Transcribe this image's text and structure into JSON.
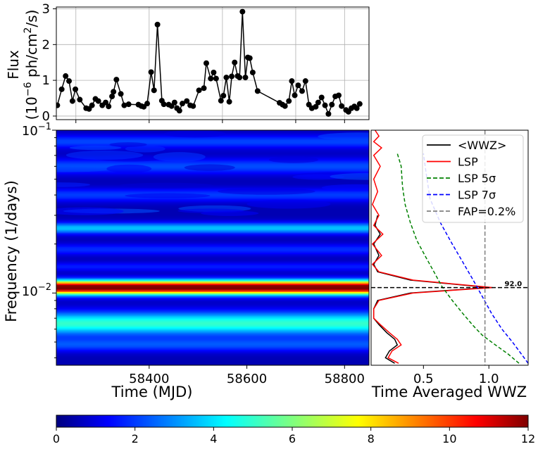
{
  "chart_data": [
    {
      "type": "line",
      "ylabel_line1": "Flux",
      "ylabel_line2_pre": "(10",
      "ylabel_line2_sup1": "−6",
      "ylabel_line2_mid": " ph/cm",
      "ylabel_line2_sup2": "2",
      "ylabel_line2_post": "/s)",
      "xlim": [
        58210,
        58850
      ],
      "ylim": [
        -0.1,
        3.05
      ],
      "yticks": [
        "0",
        "1",
        "2",
        "3"
      ],
      "xtick_values": [
        58250,
        58400,
        58550,
        58700,
        58800
      ],
      "grid": true,
      "line_color": "#000000",
      "series": [
        {
          "x": [
            58212,
            58221,
            58229,
            58236,
            58243,
            58249,
            58258,
            58271,
            58277,
            58283,
            58290,
            58296,
            58304,
            58311,
            58317,
            58324,
            58327,
            58333,
            58342,
            58349,
            58358,
            58378,
            58384,
            58389,
            58396,
            58404,
            58410,
            58417,
            58426,
            58430,
            58440,
            58446,
            58452,
            58457,
            58462,
            58468,
            58477,
            58484,
            58490,
            58502,
            58512,
            58517,
            58526,
            58532,
            58537,
            58547,
            58552,
            58558,
            58564,
            58569,
            58575,
            58581,
            58585,
            58591,
            58597,
            58602,
            58606,
            58612,
            58622,
            58667,
            58673,
            58678,
            58686,
            58692,
            58698,
            58705,
            58713,
            58720,
            58727,
            58733,
            58741,
            58746,
            58753,
            58760,
            58767,
            58774,
            58781,
            58788,
            58794,
            58803,
            58808,
            58814,
            58820,
            58825,
            58831
          ],
          "y": [
            0.3,
            0.75,
            1.12,
            0.98,
            0.42,
            0.75,
            0.46,
            0.22,
            0.2,
            0.3,
            0.48,
            0.42,
            0.3,
            0.38,
            0.27,
            0.55,
            0.68,
            1.02,
            0.62,
            0.3,
            0.33,
            0.32,
            0.28,
            0.26,
            0.35,
            1.23,
            0.72,
            2.56,
            0.43,
            0.33,
            0.32,
            0.28,
            0.38,
            0.22,
            0.15,
            0.35,
            0.42,
            0.3,
            0.28,
            0.72,
            0.78,
            1.48,
            1.05,
            1.22,
            1.05,
            0.43,
            0.57,
            1.08,
            0.4,
            1.11,
            1.5,
            1.12,
            1.08,
            2.92,
            1.08,
            1.64,
            1.62,
            1.22,
            0.7,
            0.37,
            0.32,
            0.28,
            0.42,
            0.98,
            0.58,
            0.86,
            0.7,
            0.98,
            0.32,
            0.22,
            0.26,
            0.38,
            0.52,
            0.3,
            0.06,
            0.32,
            0.55,
            0.58,
            0.28,
            0.17,
            0.12,
            0.22,
            0.27,
            0.22,
            0.34
          ]
        }
      ]
    },
    {
      "type": "heatmap",
      "xlabel": "Time (MJD)",
      "ylabel": "Frequency (1/days)",
      "xlim": [
        58210,
        58850
      ],
      "ylog": true,
      "ylim": [
        0.0036,
        0.1
      ],
      "xticks": [
        58400,
        58600,
        58800
      ],
      "ytick_labels": [
        {
          "base": "10",
          "exp": "−1",
          "value": 0.1
        },
        {
          "base": "10",
          "exp": "−2",
          "value": 0.01
        }
      ],
      "colormap": "jet",
      "peak_frequency": 0.0108,
      "bands": [
        {
          "freq": 0.0108,
          "level": 12,
          "width": 0.03
        },
        {
          "freq": 0.0065,
          "level": 4.5,
          "width": 0.05
        },
        {
          "freq": 0.0048,
          "level": 1.8,
          "width": 0.03
        },
        {
          "freq": 0.025,
          "level": 3.2,
          "width": 0.025
        },
        {
          "freq": 0.0185,
          "level": 1.4,
          "width": 0.025
        },
        {
          "freq": 0.0145,
          "level": 1.2,
          "width": 0.02
        },
        {
          "freq": 0.04,
          "level": 1.6,
          "width": 0.03
        },
        {
          "freq": 0.06,
          "level": 1.8,
          "width": 0.035
        },
        {
          "freq": 0.085,
          "level": 1.7,
          "width": 0.03
        }
      ]
    },
    {
      "type": "line",
      "xlabel": "Time Averaged WWZ",
      "xlim": [
        0.1,
        1.3
      ],
      "ylog": true,
      "ylim": [
        0.0036,
        0.1
      ],
      "xticks": [
        0.5,
        1.0
      ],
      "xtick_labels": [
        "0.5",
        "1.0"
      ],
      "fap_x": 0.97,
      "peak_frequency": 0.0108,
      "peak_annotation": "92.0",
      "legend_position": "upper right",
      "series": [
        {
          "name": "<WWZ>",
          "color": "#000000",
          "style": "solid",
          "points": [
            [
              0.28,
              0.0037
            ],
            [
              0.21,
              0.004
            ],
            [
              0.24,
              0.0044
            ],
            [
              0.3,
              0.0048
            ],
            [
              0.28,
              0.0052
            ],
            [
              0.22,
              0.0057
            ],
            [
              0.16,
              0.0064
            ],
            [
              0.12,
              0.007
            ],
            [
              0.12,
              0.008
            ],
            [
              0.15,
              0.009
            ],
            [
              0.4,
              0.01
            ],
            [
              0.85,
              0.0106
            ],
            [
              1.0,
              0.0108
            ],
            [
              0.8,
              0.0112
            ],
            [
              0.4,
              0.012
            ],
            [
              0.15,
              0.0135
            ],
            [
              0.12,
              0.015
            ],
            [
              0.16,
              0.017
            ],
            [
              0.12,
              0.02
            ],
            [
              0.17,
              0.023
            ],
            [
              0.13,
              0.026
            ],
            [
              0.15,
              0.03
            ]
          ]
        },
        {
          "name": "LSP",
          "color": "#ff0000",
          "style": "solid",
          "points": [
            [
              0.31,
              0.0037
            ],
            [
              0.23,
              0.004
            ],
            [
              0.26,
              0.0044
            ],
            [
              0.33,
              0.0048
            ],
            [
              0.3,
              0.0052
            ],
            [
              0.24,
              0.0057
            ],
            [
              0.17,
              0.0064
            ],
            [
              0.12,
              0.007
            ],
            [
              0.12,
              0.008
            ],
            [
              0.16,
              0.009
            ],
            [
              0.42,
              0.01
            ],
            [
              0.88,
              0.0106
            ],
            [
              1.03,
              0.0108
            ],
            [
              0.82,
              0.0112
            ],
            [
              0.42,
              0.012
            ],
            [
              0.16,
              0.0135
            ],
            [
              0.11,
              0.015
            ],
            [
              0.18,
              0.017
            ],
            [
              0.11,
              0.02
            ],
            [
              0.19,
              0.023
            ],
            [
              0.12,
              0.026
            ],
            [
              0.16,
              0.03
            ],
            [
              0.11,
              0.035
            ],
            [
              0.15,
              0.042
            ],
            [
              0.12,
              0.05
            ],
            [
              0.17,
              0.06
            ],
            [
              0.12,
              0.07
            ],
            [
              0.18,
              0.078
            ],
            [
              0.12,
              0.085
            ],
            [
              0.16,
              0.092
            ],
            [
              0.13,
              0.1
            ]
          ]
        },
        {
          "name": "LSP 5σ",
          "color": "#008000",
          "style": "dashed",
          "points": [
            [
              1.23,
              0.0037
            ],
            [
              1.15,
              0.0042
            ],
            [
              1.05,
              0.0048
            ],
            [
              0.95,
              0.0055
            ],
            [
              0.88,
              0.0063
            ],
            [
              0.8,
              0.0075
            ],
            [
              0.72,
              0.009
            ],
            [
              0.64,
              0.011
            ],
            [
              0.58,
              0.0135
            ],
            [
              0.52,
              0.0165
            ],
            [
              0.45,
              0.021
            ],
            [
              0.4,
              0.027
            ],
            [
              0.36,
              0.035
            ],
            [
              0.34,
              0.045
            ],
            [
              0.33,
              0.06
            ],
            [
              0.3,
              0.072
            ]
          ]
        },
        {
          "name": "LSP 7σ",
          "color": "#0000ff",
          "style": "dashed",
          "points": [
            [
              1.3,
              0.0037
            ],
            [
              1.25,
              0.0042
            ],
            [
              1.18,
              0.005
            ],
            [
              1.1,
              0.006
            ],
            [
              1.02,
              0.0075
            ],
            [
              0.95,
              0.0095
            ],
            [
              0.88,
              0.012
            ],
            [
              0.8,
              0.0155
            ],
            [
              0.72,
              0.02
            ],
            [
              0.63,
              0.027
            ],
            [
              0.55,
              0.038
            ],
            [
              0.52,
              0.055
            ],
            [
              0.5,
              0.072
            ]
          ]
        },
        {
          "name": "FAP=0.2%",
          "color": "#808080",
          "style": "dashed",
          "points": []
        }
      ],
      "legend": [
        {
          "label": "<WWZ>",
          "color": "#000000",
          "dash": ""
        },
        {
          "label": "LSP",
          "color": "#ff0000",
          "dash": ""
        },
        {
          "label": "LSP 5σ",
          "color": "#008000",
          "dash": "6,3"
        },
        {
          "label": "LSP 7σ",
          "color": "#0000ff",
          "dash": "6,3"
        },
        {
          "label": "FAP=0.2%",
          "color": "#808080",
          "dash": "6,3"
        }
      ]
    },
    {
      "type": "colorbar",
      "colormap": "jet",
      "range": [
        0,
        12
      ],
      "ticks": [
        "0",
        "2",
        "4",
        "6",
        "8",
        "10",
        "12"
      ]
    }
  ]
}
